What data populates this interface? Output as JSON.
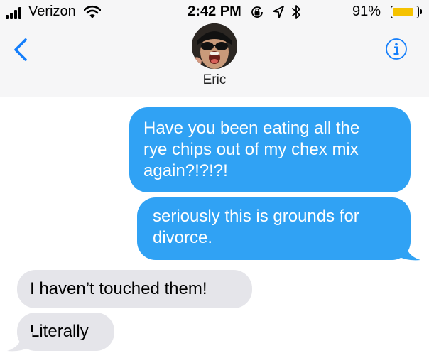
{
  "status_bar": {
    "carrier": "Verizon",
    "time": "2:42 PM",
    "battery_percent": "91%",
    "battery_level": 0.91,
    "icons": [
      "signal-icon",
      "wifi-icon",
      "rotation-lock-icon",
      "location-icon",
      "bluetooth-icon",
      "battery-icon"
    ]
  },
  "conversation": {
    "contact_name": "Eric",
    "back_icon": "chevron-left-icon",
    "info_icon": "info-icon"
  },
  "messages": [
    {
      "direction": "sent",
      "lines": [
        "Have you been eating all the",
        "rye chips out of my chex mix",
        "again?!?!?!"
      ]
    },
    {
      "direction": "sent",
      "lines": [
        "seriously this is grounds for",
        "divorce."
      ]
    },
    {
      "direction": "received",
      "lines": [
        "I haven’t touched them!"
      ]
    },
    {
      "direction": "received",
      "lines": [
        "Literally"
      ]
    }
  ],
  "colors": {
    "sent_bubble": "#30a2f4",
    "received_bubble": "#e5e5ea",
    "accent": "#147efb",
    "battery_fill": "#f5c200"
  }
}
